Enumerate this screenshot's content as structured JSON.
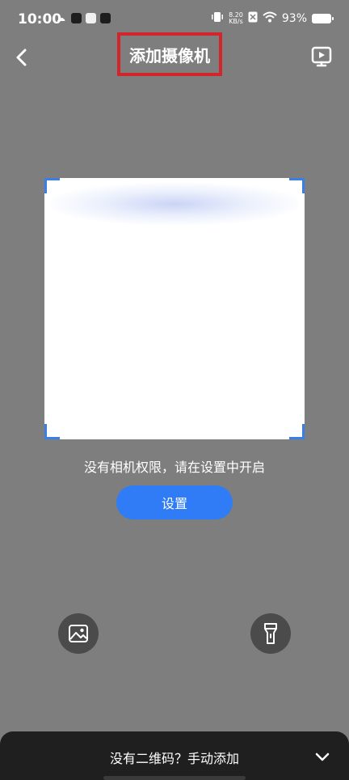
{
  "status_bar": {
    "time": "10:00",
    "net_speed_value": "8.20",
    "net_speed_unit": "KB/s",
    "battery": "93%"
  },
  "header": {
    "title": "添加摄像机"
  },
  "scan": {
    "message": "没有相机权限，请在设置中开启",
    "settings_label": "设置"
  },
  "bottom_sheet": {
    "manual_add_label": "没有二维码？手动添加"
  },
  "icons": {
    "back": "back-icon",
    "video": "video-icon",
    "gallery": "gallery-icon",
    "flashlight": "flashlight-icon",
    "chevron": "chevron-down-icon"
  },
  "colors": {
    "background": "#7e7e7e",
    "accent": "#2f7cf6",
    "highlight_box": "#d3252c",
    "scan_corner": "#3a7ee8"
  }
}
